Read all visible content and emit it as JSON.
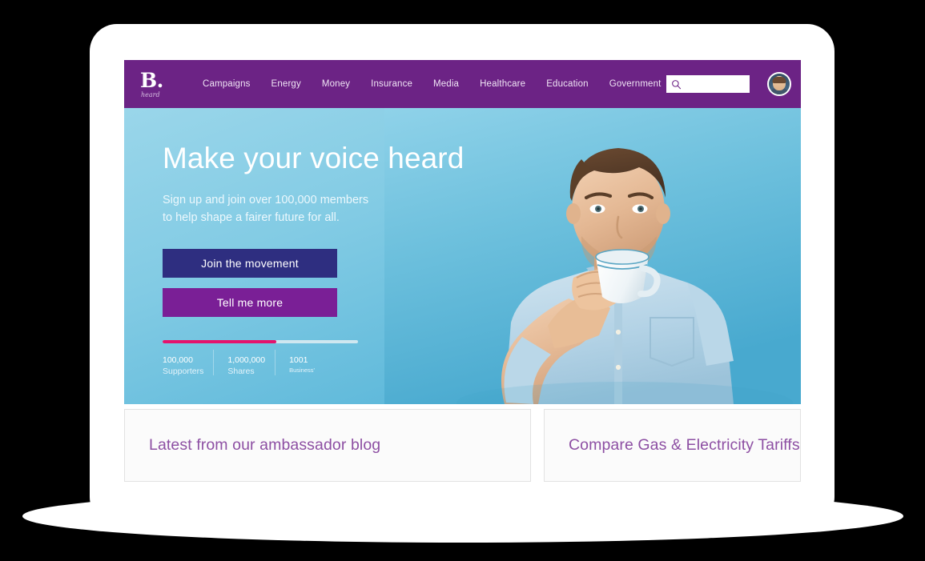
{
  "brand": {
    "mark": "B.",
    "sub": "heard"
  },
  "nav": {
    "links": [
      {
        "label": "Campaigns"
      },
      {
        "label": "Energy"
      },
      {
        "label": "Money"
      },
      {
        "label": "Insurance"
      },
      {
        "label": "Media"
      },
      {
        "label": "Healthcare"
      },
      {
        "label": "Education"
      },
      {
        "label": "Government"
      }
    ],
    "search": {
      "value": "",
      "placeholder": "",
      "icon": "search-icon"
    },
    "avatar": {
      "icon": "user-avatar"
    },
    "background_color": "#6c2385"
  },
  "hero": {
    "title": "Make your voice heard",
    "subtitle_line1": "Sign up and join over 100,000 members",
    "subtitle_line2": "to help shape a fairer future for all.",
    "buttons": {
      "primary": "Join the movement",
      "secondary": "Tell me more"
    },
    "progress": {
      "percent": 58,
      "fill_color": "#e5136c",
      "track_color": "#cfe7f0"
    },
    "stats": [
      {
        "value": "100,000",
        "label": "Supporters"
      },
      {
        "value": "1,000,000",
        "label": "Shares"
      },
      {
        "value": "1001",
        "label": "Business'"
      }
    ],
    "photo_alt": "man-drinking-from-mug",
    "background_color": "#82cbe4"
  },
  "cards": [
    {
      "title": "Latest from our ambassador blog"
    },
    {
      "title": "Compare Gas & Electricity Tariffs"
    }
  ],
  "colors": {
    "brand_purple": "#6c2385",
    "accent_pink": "#e5136c",
    "card_title_purple": "#8d4fa3",
    "cta_navy": "#2e2e80",
    "cta_purple": "#7a1f96"
  }
}
